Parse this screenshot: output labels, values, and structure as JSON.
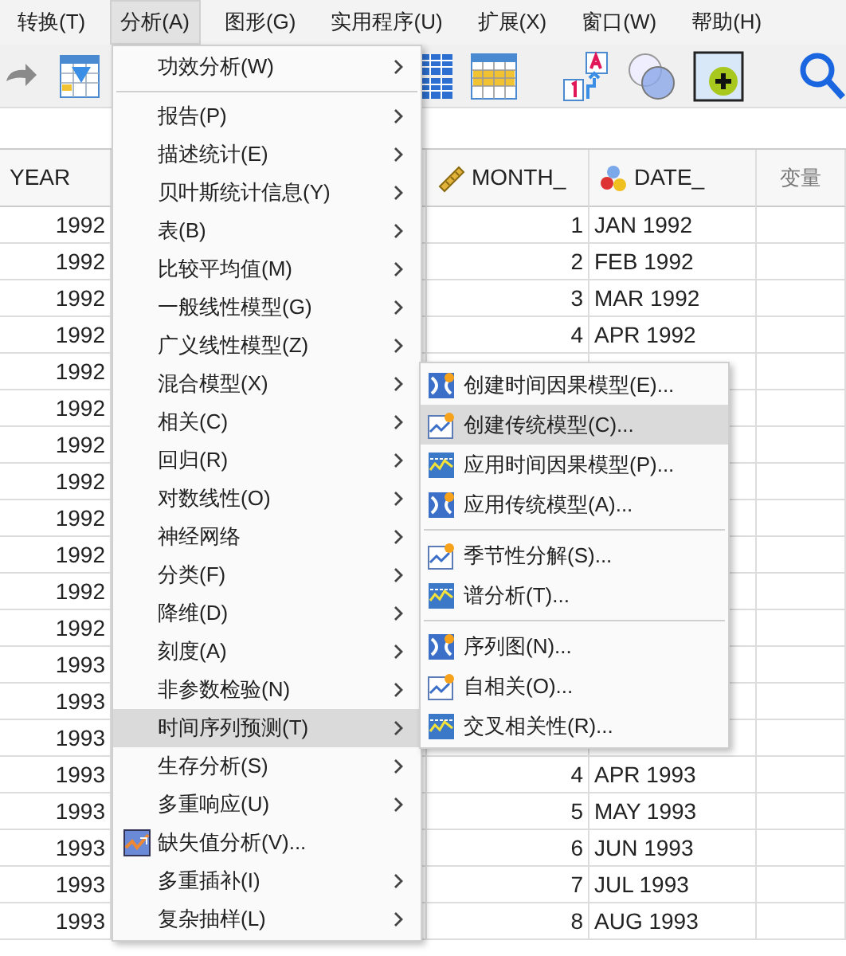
{
  "menubar": [
    {
      "label": "转换(T)",
      "selected": false
    },
    {
      "label": "分析(A)",
      "selected": true
    },
    {
      "label": "图形(G)",
      "selected": false
    },
    {
      "label": "实用程序(U)",
      "selected": false
    },
    {
      "label": "扩展(X)",
      "selected": false
    },
    {
      "label": "窗口(W)",
      "selected": false
    },
    {
      "label": "帮助(H)",
      "selected": false
    }
  ],
  "table": {
    "columns": [
      {
        "label": "YEAR",
        "kind": "plain"
      },
      {
        "label": "MONTH_",
        "kind": "scale"
      },
      {
        "label": "DATE_",
        "kind": "nominal"
      },
      {
        "label": "变量",
        "kind": "empty"
      }
    ],
    "rows": [
      {
        "year": "1992",
        "month": "1",
        "date": "JAN 1992"
      },
      {
        "year": "1992",
        "month": "2",
        "date": "FEB 1992"
      },
      {
        "year": "1992",
        "month": "3",
        "date": "MAR 1992"
      },
      {
        "year": "1992",
        "month": "4",
        "date": "APR 1992"
      },
      {
        "year": "1992"
      },
      {
        "year": "1992"
      },
      {
        "year": "1992"
      },
      {
        "year": "1992"
      },
      {
        "year": "1992"
      },
      {
        "year": "1992"
      },
      {
        "year": "1992"
      },
      {
        "year": "1992"
      },
      {
        "year": "1993"
      },
      {
        "year": "1993"
      },
      {
        "year": "1993"
      },
      {
        "year": "1993",
        "month": "4",
        "date": "APR 1993"
      },
      {
        "year": "1993",
        "month": "5",
        "date": "MAY 1993"
      },
      {
        "year": "1993",
        "month": "6",
        "date": "JUN 1993"
      },
      {
        "year": "1993",
        "month": "7",
        "date": "JUL 1993"
      },
      {
        "year": "1993",
        "month": "8",
        "date": "AUG 1993"
      }
    ]
  },
  "menu": {
    "groups": [
      {
        "items": [
          {
            "label": "功效分析(W)",
            "submenu": true,
            "selected": false
          }
        ]
      },
      {
        "items": [
          {
            "label": "报告(P)",
            "submenu": true,
            "selected": false
          },
          {
            "label": "描述统计(E)",
            "submenu": true,
            "selected": false
          },
          {
            "label": "贝叶斯统计信息(Y)",
            "submenu": true,
            "selected": false
          },
          {
            "label": "表(B)",
            "submenu": true,
            "selected": false
          },
          {
            "label": "比较平均值(M)",
            "submenu": true,
            "selected": false
          },
          {
            "label": "一般线性模型(G)",
            "submenu": true,
            "selected": false
          },
          {
            "label": "广义线性模型(Z)",
            "submenu": true,
            "selected": false
          },
          {
            "label": "混合模型(X)",
            "submenu": true,
            "selected": false
          },
          {
            "label": "相关(C)",
            "submenu": true,
            "selected": false
          },
          {
            "label": "回归(R)",
            "submenu": true,
            "selected": false
          },
          {
            "label": "对数线性(O)",
            "submenu": true,
            "selected": false
          },
          {
            "label": "神经网络",
            "submenu": true,
            "selected": false
          },
          {
            "label": "分类(F)",
            "submenu": true,
            "selected": false
          },
          {
            "label": "降维(D)",
            "submenu": true,
            "selected": false
          },
          {
            "label": "刻度(A)",
            "submenu": true,
            "selected": false
          },
          {
            "label": "非参数检验(N)",
            "submenu": true,
            "selected": false
          },
          {
            "label": "时间序列预测(T)",
            "submenu": true,
            "selected": true
          },
          {
            "label": "生存分析(S)",
            "submenu": true,
            "selected": false
          },
          {
            "label": "多重响应(U)",
            "submenu": true,
            "selected": false
          },
          {
            "label": "缺失值分析(V)...",
            "submenu": false,
            "icon": true,
            "selected": false
          },
          {
            "label": "多重插补(I)",
            "submenu": true,
            "selected": false
          },
          {
            "label": "复杂抽样(L)",
            "submenu": true,
            "selected": false
          }
        ]
      }
    ]
  },
  "submenu": {
    "groups": [
      {
        "items": [
          {
            "label": "创建时间因果模型(E)...",
            "selected": false
          },
          {
            "label": "创建传统模型(C)...",
            "selected": true
          },
          {
            "label": "应用时间因果模型(P)...",
            "selected": false
          },
          {
            "label": "应用传统模型(A)...",
            "selected": false
          }
        ]
      },
      {
        "items": [
          {
            "label": "季节性分解(S)...",
            "selected": false
          },
          {
            "label": "谱分析(T)...",
            "selected": false
          }
        ]
      },
      {
        "items": [
          {
            "label": "序列图(N)...",
            "selected": false
          },
          {
            "label": "自相关(O)...",
            "selected": false
          },
          {
            "label": "交叉相关性(R)...",
            "selected": false
          }
        ]
      }
    ]
  }
}
